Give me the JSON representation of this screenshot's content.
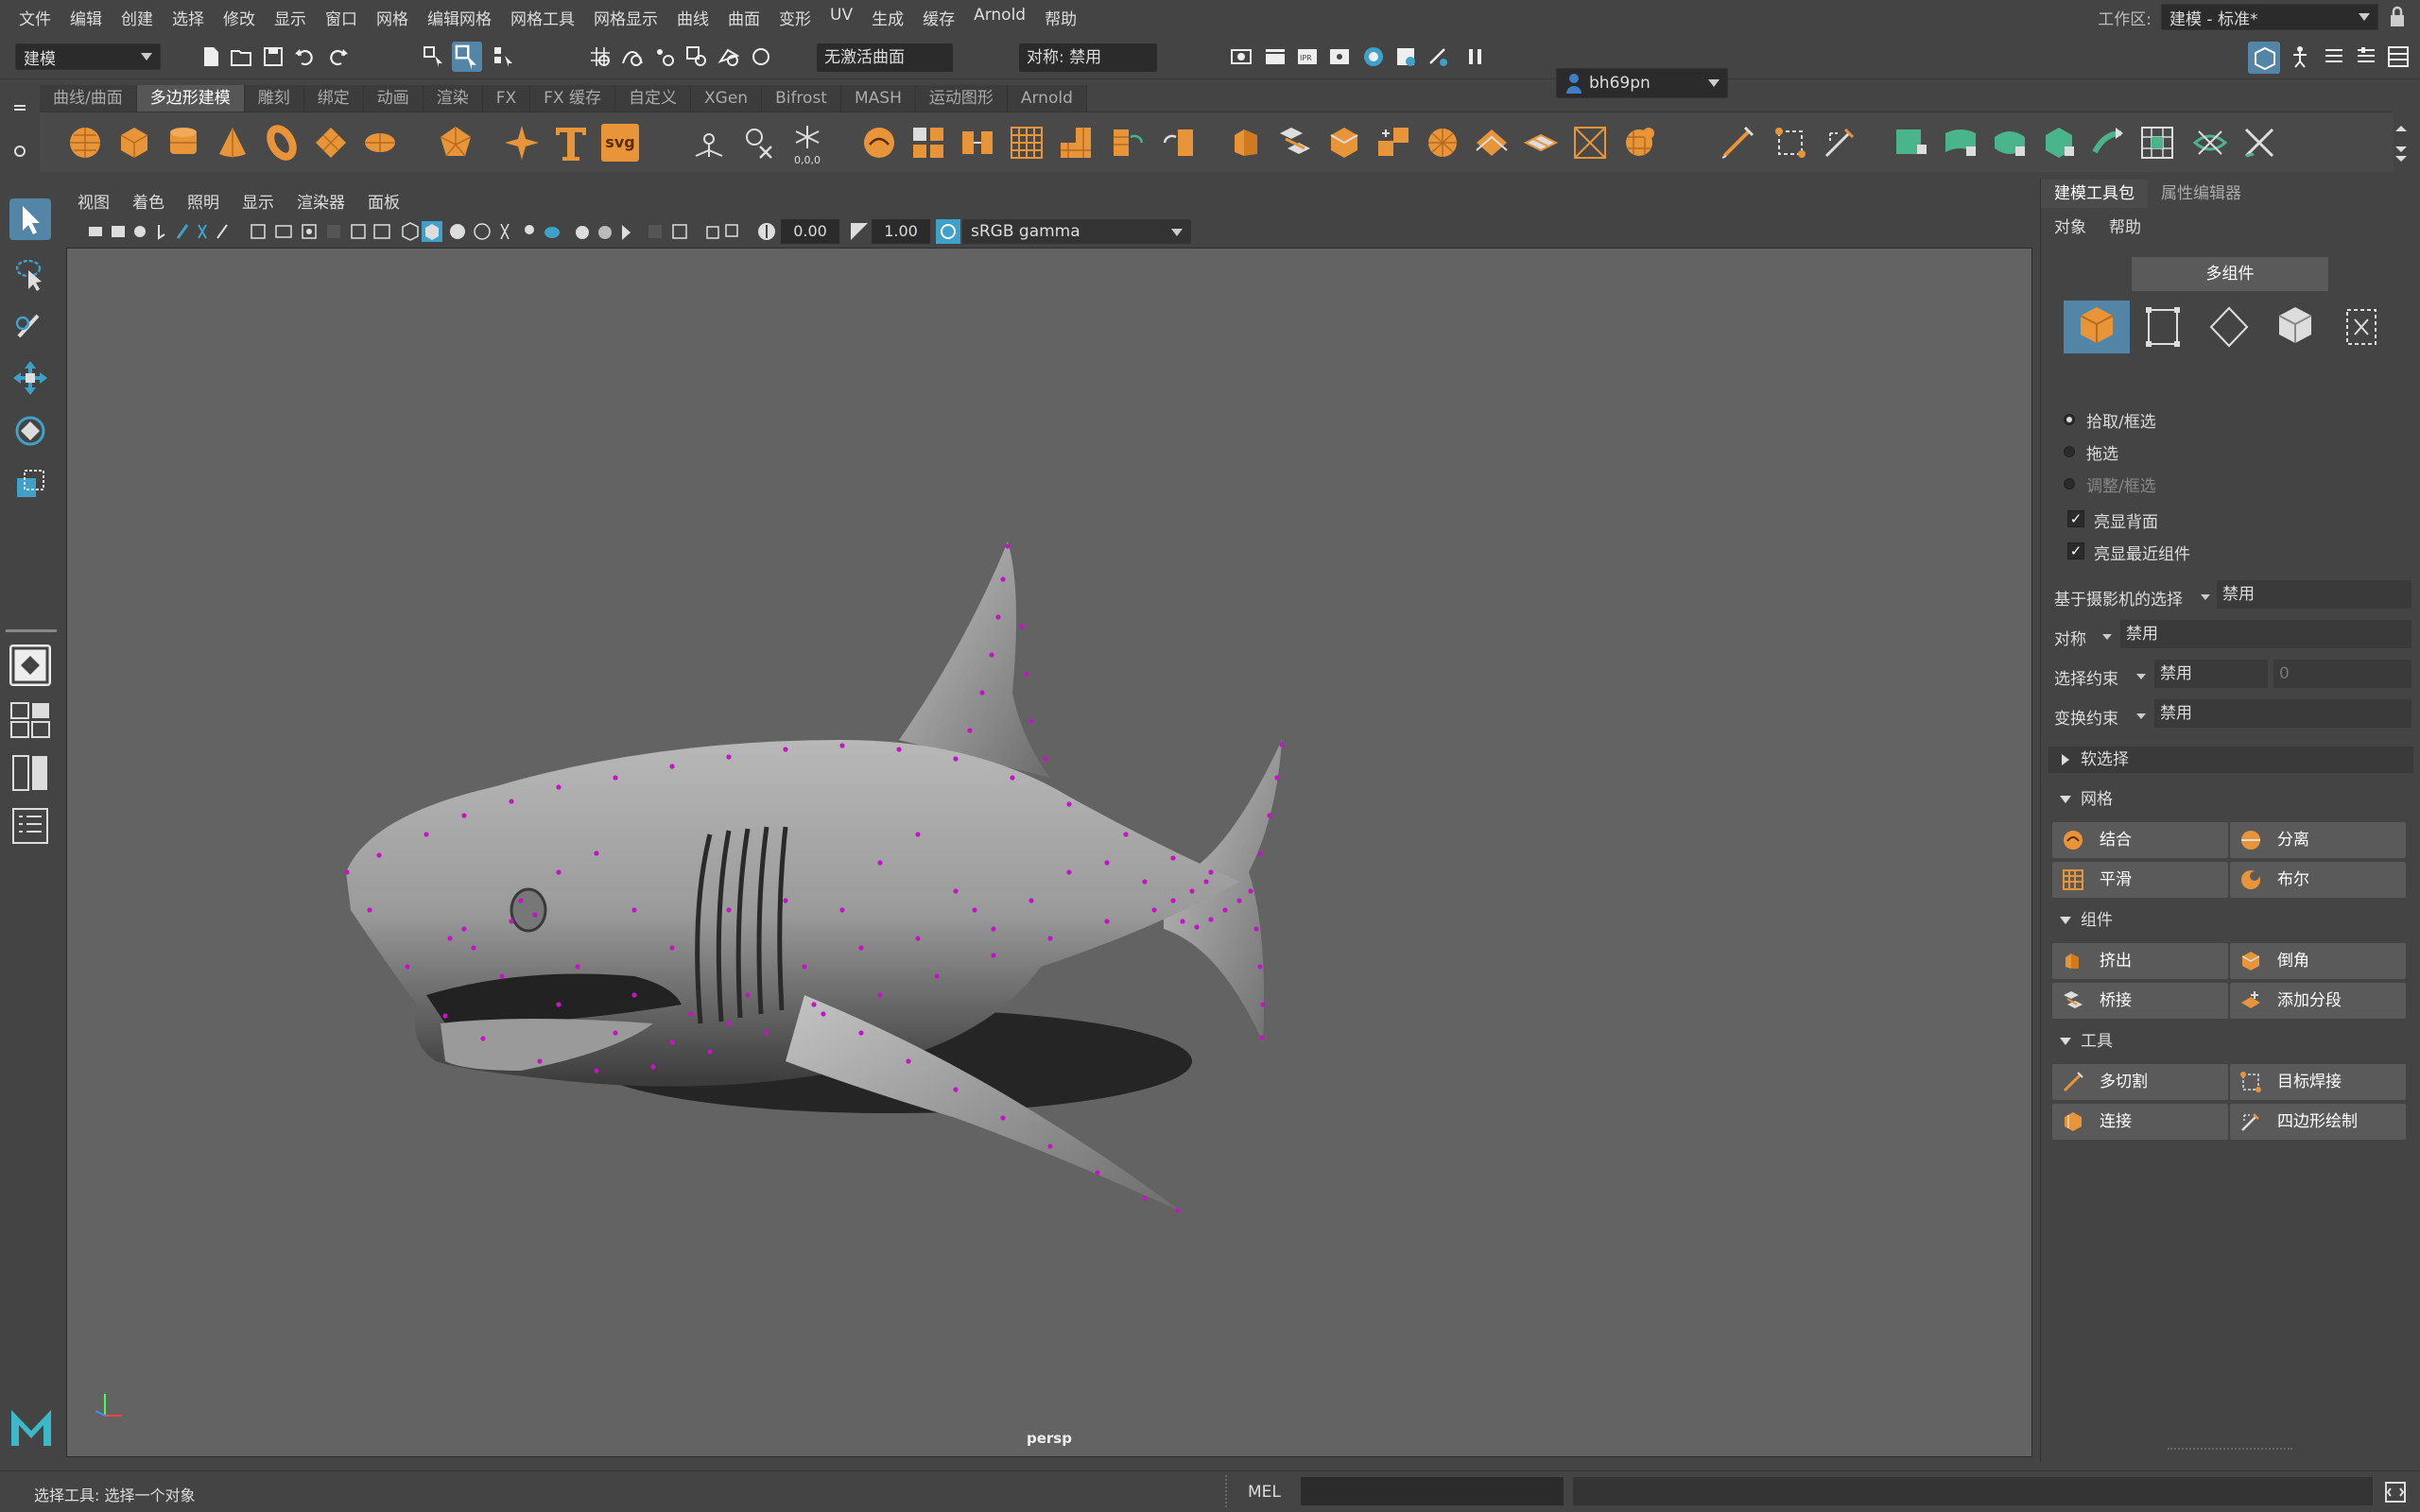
{
  "menu": [
    "文件",
    "编辑",
    "创建",
    "选择",
    "修改",
    "显示",
    "窗口",
    "网格",
    "编辑网格",
    "网格工具",
    "网格显示",
    "曲线",
    "曲面",
    "变形",
    "UV",
    "生成",
    "缓存",
    "Arnold",
    "帮助"
  ],
  "workspace": {
    "label": "工作区:",
    "value": "建模 - 标准*"
  },
  "statusline": {
    "mode": "建模",
    "live_surface": "无激活曲面",
    "symmetry": "对称: 禁用",
    "user": "bh69pn"
  },
  "shelf_tabs": [
    "曲线/曲面",
    "多边形建模",
    "雕刻",
    "绑定",
    "动画",
    "渲染",
    "FX",
    "FX 缓存",
    "自定义",
    "XGen",
    "Bifrost",
    "MASH",
    "运动图形",
    "Arnold"
  ],
  "shelf_active_tab": "多边形建模",
  "shelf_text_icons": {
    "svg": "svg",
    "coords": "0,0,0"
  },
  "viewport": {
    "menu": [
      "视图",
      "着色",
      "照明",
      "显示",
      "渲染器",
      "面板"
    ],
    "exposure": "0.00",
    "gamma": "1.00",
    "color_space": "sRGB gamma",
    "camera": "persp"
  },
  "panel": {
    "tabs": [
      "建模工具包",
      "属性编辑器"
    ],
    "menu": [
      "对象",
      "帮助"
    ],
    "multi_component": "多组件",
    "selection_modes": [
      "pick-marquee",
      "drag",
      "tweak-marquee"
    ],
    "radio_labels": [
      "拾取/框选",
      "拖选",
      "调整/框选"
    ],
    "checkboxes": [
      "亮显背面",
      "亮显最近组件"
    ],
    "camera_based_selection": {
      "label": "基于摄影机的选择",
      "value": "禁用"
    },
    "symmetry": {
      "label": "对称",
      "value": "禁用"
    },
    "selection_constraint": {
      "label": "选择约束",
      "value": "禁用",
      "number": "0"
    },
    "transform_constraint": {
      "label": "变换约束",
      "value": "禁用"
    },
    "soft_select": "软选择",
    "sections": [
      {
        "title": "网格",
        "buttons": [
          "结合",
          "分离",
          "平滑",
          "布尔"
        ]
      },
      {
        "title": "组件",
        "buttons": [
          "挤出",
          "倒角",
          "桥接",
          "添加分段"
        ]
      },
      {
        "title": "工具",
        "buttons": [
          "多切割",
          "目标焊接",
          "连接",
          "四边形绘制"
        ]
      }
    ]
  },
  "bottom": {
    "help_line": "选择工具: 选择一个对象",
    "script_lang": "MEL"
  },
  "colors": {
    "accent": "#5285a6",
    "shelf_orange": "#e8953a",
    "shelf_green": "#4ab48c",
    "vertex": "#c415c4"
  }
}
